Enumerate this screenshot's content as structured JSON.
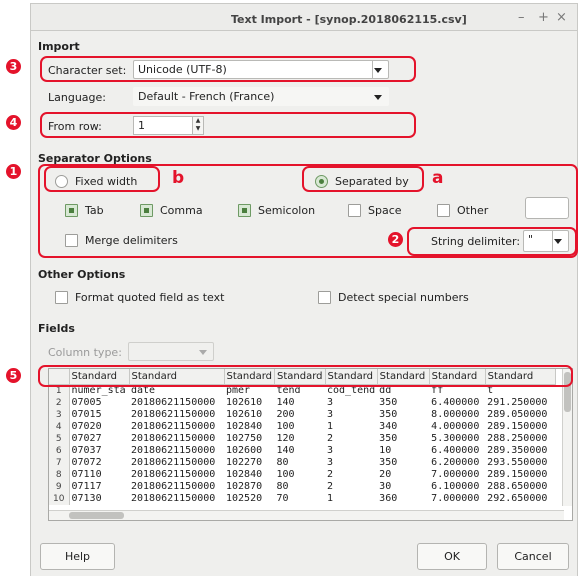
{
  "window": {
    "title": "Text Import - [synop.2018062115.csv]",
    "controls": [
      "–",
      "+",
      "×"
    ]
  },
  "import": {
    "heading": "Import",
    "charset_label": "Character set:",
    "charset_value": "Unicode (UTF-8)",
    "language_label": "Language:",
    "language_value": "Default - French (France)",
    "from_row_label": "From row:",
    "from_row_value": "1"
  },
  "separator": {
    "heading": "Separator Options",
    "fixed_width": "Fixed width",
    "separated_by": "Separated by",
    "tab": "Tab",
    "comma": "Comma",
    "semicolon": "Semicolon",
    "space": "Space",
    "other": "Other",
    "merge": "Merge delimiters",
    "string_delim_label": "String delimiter:",
    "string_delim_value": "\"",
    "state": {
      "tab": true,
      "comma": true,
      "semicolon": true,
      "space": false,
      "other": false,
      "merge": false,
      "mode": "separated"
    }
  },
  "other_options": {
    "heading": "Other Options",
    "format_quoted": "Format quoted field as text",
    "detect_special": "Detect special numbers"
  },
  "fields": {
    "heading": "Fields",
    "column_type_label": "Column type:",
    "headers": [
      "Standard",
      "Standard",
      "Standard",
      "Standard",
      "Standard",
      "Standard",
      "Standard",
      "Standard"
    ],
    "rows": [
      [
        "1",
        "numer_sta",
        "date",
        "pmer",
        "tend",
        "cod_tend",
        "dd",
        "ff",
        "t"
      ],
      [
        "2",
        "07005",
        "20180621150000",
        "102610",
        "140",
        "3",
        "350",
        "6.400000",
        "291.250000"
      ],
      [
        "3",
        "07015",
        "20180621150000",
        "102610",
        "200",
        "3",
        "350",
        "8.000000",
        "289.050000"
      ],
      [
        "4",
        "07020",
        "20180621150000",
        "102840",
        "100",
        "1",
        "340",
        "4.000000",
        "289.150000"
      ],
      [
        "5",
        "07027",
        "20180621150000",
        "102750",
        "120",
        "2",
        "350",
        "5.300000",
        "288.250000"
      ],
      [
        "6",
        "07037",
        "20180621150000",
        "102600",
        "140",
        "3",
        "10",
        "6.400000",
        "289.350000"
      ],
      [
        "7",
        "07072",
        "20180621150000",
        "102270",
        "80",
        "3",
        "350",
        "6.200000",
        "293.550000"
      ],
      [
        "8",
        "07110",
        "20180621150000",
        "102840",
        "100",
        "2",
        "20",
        "7.000000",
        "289.150000"
      ],
      [
        "9",
        "07117",
        "20180621150000",
        "102870",
        "80",
        "2",
        "30",
        "6.100000",
        "288.650000"
      ],
      [
        "10",
        "07130",
        "20180621150000",
        "102520",
        "70",
        "1",
        "360",
        "7.000000",
        "292.650000"
      ]
    ]
  },
  "buttons": {
    "help": "Help",
    "ok": "OK",
    "cancel": "Cancel"
  },
  "annotations": {
    "n1": "1",
    "n2": "2",
    "n3": "3",
    "n4": "4",
    "n5": "5",
    "a": "a",
    "b": "b"
  },
  "colors": {
    "annotation": "#e4132b",
    "checkbox_on": "#4b7f3e"
  }
}
